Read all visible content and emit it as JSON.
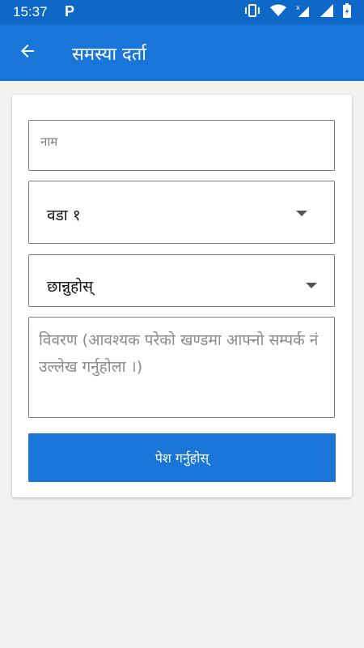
{
  "status_bar": {
    "time": "15:37",
    "app_indicator": "P",
    "icons": [
      "vibrate-icon",
      "wifi-icon",
      "signal-no-data-icon",
      "signal-icon",
      "battery-charging-icon"
    ]
  },
  "app_bar": {
    "back_icon": "arrow-left-icon",
    "title": "समस्या दर्ता"
  },
  "form": {
    "name_field": {
      "placeholder": "नाम",
      "value": ""
    },
    "ward_select": {
      "selected": "वडा १"
    },
    "category_select": {
      "selected": "छान्नुहोस्"
    },
    "description_field": {
      "placeholder": "विवरण (आवश्यक परेको खण्डमा आफ्नो सम्पर्क नं उल्लेख गर्नुहोला ।)",
      "value": ""
    },
    "submit_label": "पेश गर्नुहोस्"
  },
  "colors": {
    "status_bar": "#0d68c8",
    "app_bar": "#1976d8",
    "button": "#1976d8",
    "background": "#f2f2f2"
  }
}
